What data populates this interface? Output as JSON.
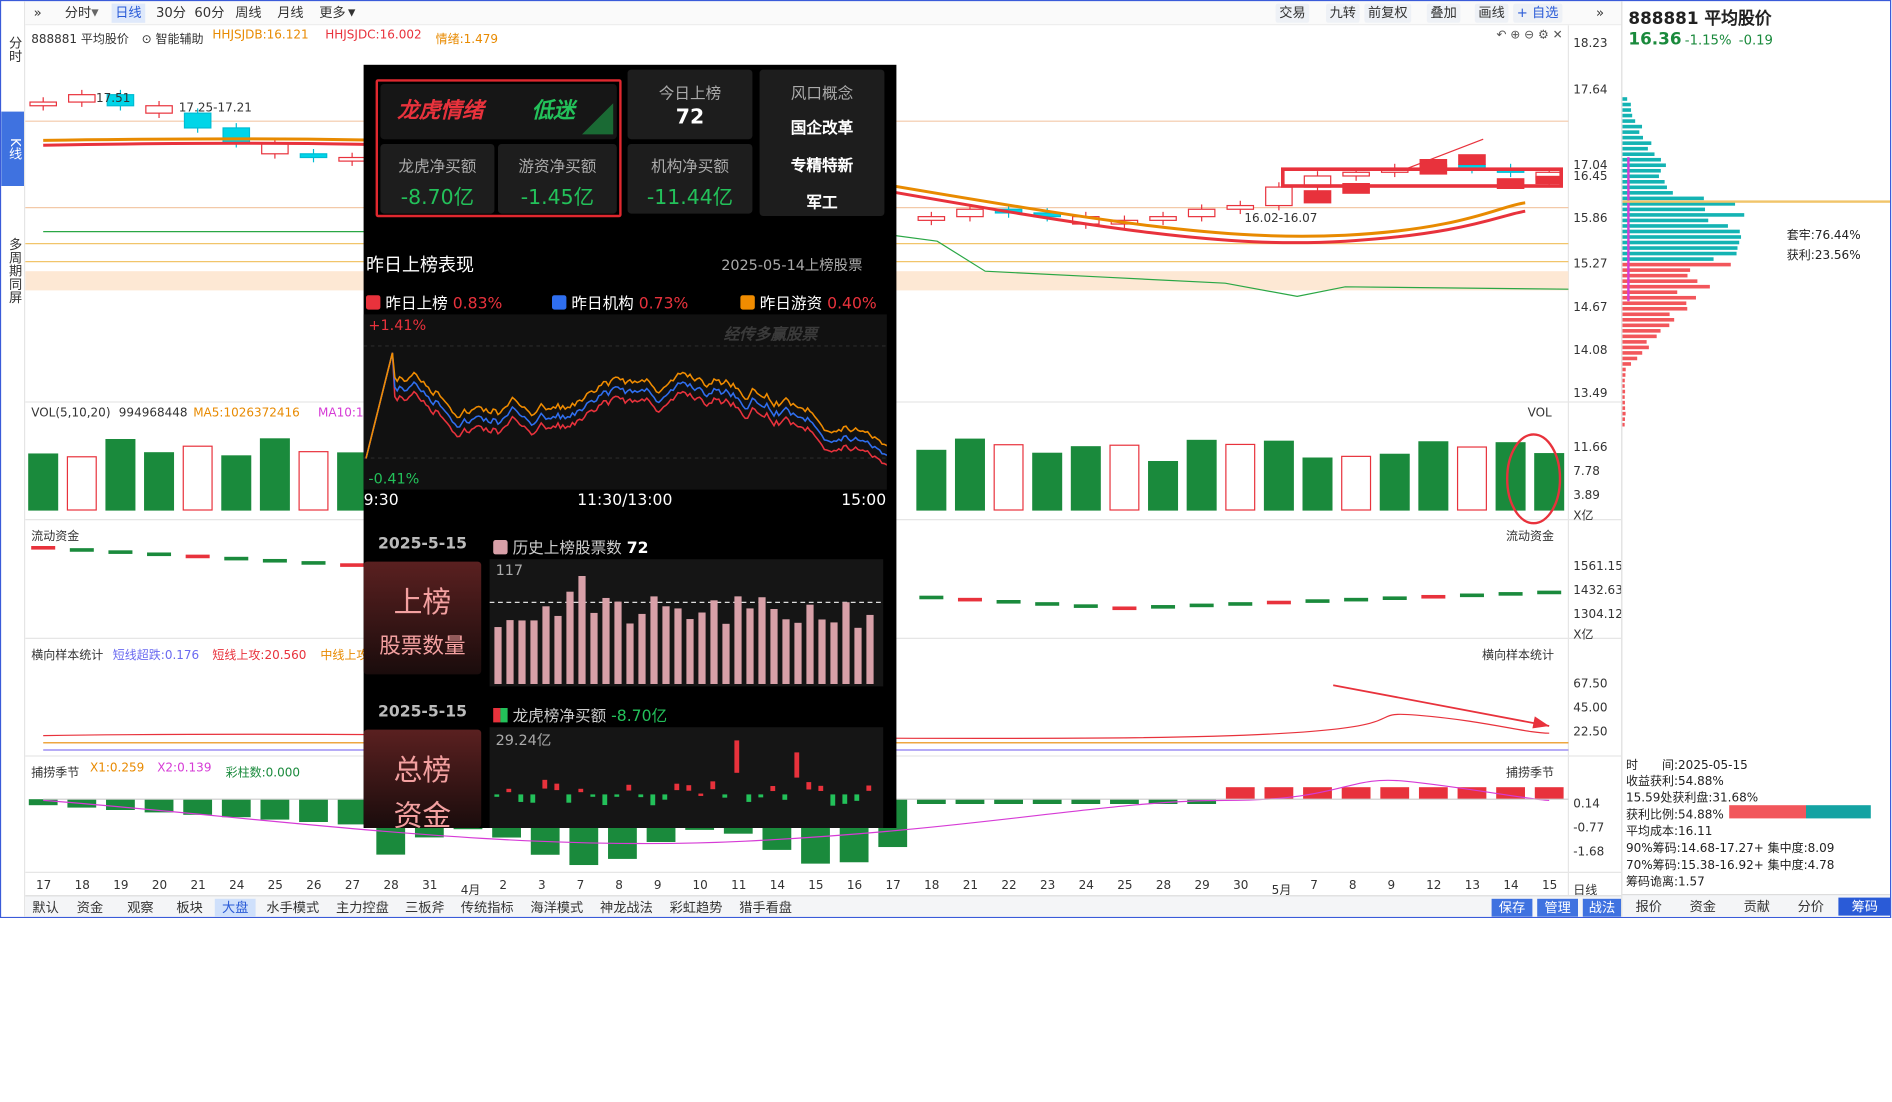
{
  "left_tabs": [
    "分时",
    "K线",
    "多周期同屏"
  ],
  "toolbar": {
    "left": [
      "»",
      "分时",
      "日线",
      "30分",
      "60分",
      "周线",
      "月线",
      "更多"
    ],
    "right": [
      "交易",
      "九转",
      "前复权",
      "叠加",
      "画线",
      "+ 自选",
      "»"
    ]
  },
  "main": {
    "title": "888881 平均股价",
    "assist": "智能辅助",
    "hhjsjdb": "HHJSJDB:16.121",
    "hhjsjdc": "HHJSJDC:16.002",
    "qingxu": "情绪:1.479",
    "price_axis": [
      "18.23",
      "17.64",
      "17.04",
      "16.45",
      "15.86",
      "15.27",
      "14.67",
      "14.08",
      "13.49"
    ],
    "annot_high": "17.51",
    "annot_range": "17.25-17.21",
    "annot_range2": "16.02-16.07"
  },
  "vol": {
    "title": "VOL(5,10,20)",
    "value": "994968448",
    "ma5": "MA5:1026372416",
    "ma10": "MA10:1",
    "axis": [
      "11.66",
      "7.78",
      "3.89",
      "X亿"
    ],
    "label": "VOL"
  },
  "flow": {
    "title": "流动资金",
    "axis": [
      "1561.15",
      "1432.63",
      "1304.12",
      "X亿"
    ],
    "label": "流动资金"
  },
  "sample": {
    "title": "横向样本统计",
    "a": "短线超跌:0.176",
    "b": "短线上攻:20.560",
    "c": "中线上攻",
    "axis": [
      "67.50",
      "45.00",
      "22.50"
    ],
    "label": "横向样本统计"
  },
  "season": {
    "title": "捕捞季节",
    "x1": "X1:0.259",
    "x2": "X2:0.139",
    "cz": "彩柱数:0.000",
    "axis": [
      "0.14",
      "-0.77",
      "-1.68"
    ],
    "label": "捕捞季节"
  },
  "dates": [
    "17",
    "18",
    "19",
    "20",
    "21",
    "24",
    "25",
    "26",
    "27",
    "28",
    "31",
    "4月",
    "2",
    "3",
    "7",
    "8",
    "9",
    "10",
    "11",
    "14",
    "15",
    "16",
    "17",
    "18",
    "21",
    "22",
    "23",
    "24",
    "25",
    "28",
    "29",
    "30",
    "5月",
    "7",
    "8",
    "9",
    "12",
    "13",
    "14",
    "15"
  ],
  "date_right": "日线",
  "bottom_tabs": [
    "默认",
    "资金",
    "观察",
    "板块",
    "大盘",
    "水手模式",
    "主力控盘",
    "三板斧",
    "传统指标",
    "海洋模式",
    "神龙战法",
    "彩虹趋势",
    "猎手看盘"
  ],
  "bottom_right": [
    "保存",
    "管理",
    "战法"
  ],
  "right": {
    "title": "888881 平均股价",
    "price": "16.36",
    "pct": "-1.15%",
    "chg": "-0.19",
    "tao": "套牢:76.44%",
    "huo": "获利:23.56%",
    "time": "时　　间:2025-05-15",
    "income": "收益获利:54.88%",
    "cost_at": "15.59处获利盘:31.68%",
    "ratio": "获利比例:54.88%",
    "avg": "平均成本:16.11",
    "c90": "90%筹码:14.68-17.27+ 集中度:8.09",
    "c70": "70%筹码:15.38-16.92+ 集中度:4.78",
    "gap": "筹码诡离:1.57",
    "tabs": [
      "报价",
      "资金",
      "贡献",
      "分价",
      "筹码"
    ]
  },
  "overlay": {
    "mood_title": "龙虎情绪",
    "mood_state": "低迷",
    "today_label": "今日上榜",
    "today_value": "72",
    "concept_title": "风口概念",
    "concepts": [
      "国企改革",
      "专精特新",
      "军工"
    ],
    "lh_label": "龙虎净买额",
    "lh_value": "-8.70亿",
    "yz_label": "游资净买额",
    "yz_value": "-1.45亿",
    "jg_label": "机构净买额",
    "jg_value": "-11.44亿",
    "perf_title": "昨日上榜表现",
    "perf_date": "2025-05-14上榜股票",
    "leg1": "昨日上榜",
    "leg1v": "0.83%",
    "leg2": "昨日机构",
    "leg2v": "0.73%",
    "leg3": "昨日游资",
    "leg3v": "0.40%",
    "ymax": "+1.41%",
    "ymin": "-0.41%",
    "t1": "9:30",
    "t2": "11:30/13:00",
    "t3": "15:00",
    "watermark": "经传多赢股票",
    "date1": "2025-5-15",
    "hist_label": "历史上榜股票数",
    "hist_value": "72",
    "sec1a": "上榜",
    "sec1b": "股票数量",
    "hist_max": "117",
    "date2": "2025-5-15",
    "net_label": "龙虎榜净买额",
    "net_value": "-8.70亿",
    "sec2a": "总榜",
    "sec2b": "资金",
    "net_max": "29.24亿"
  },
  "colors": {
    "up": "#e8323c",
    "down": "#1a8a3c",
    "accent": "#3f72e0",
    "orange": "#e88a00"
  }
}
